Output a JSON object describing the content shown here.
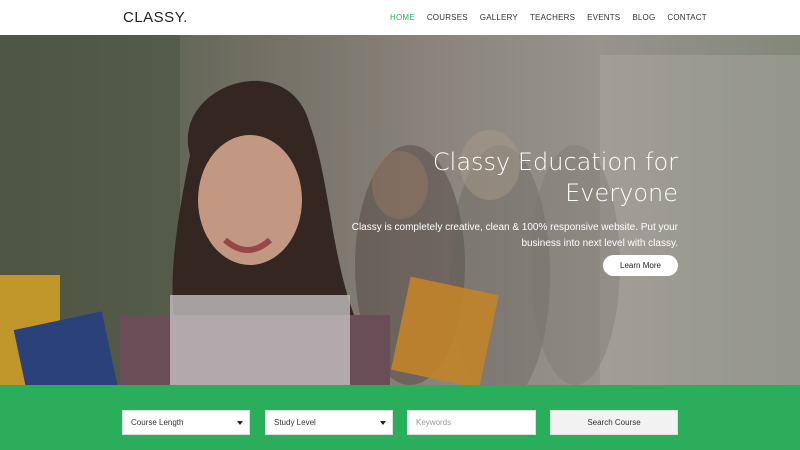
{
  "header": {
    "logo": "CLASSY.",
    "nav": [
      {
        "label": "HOME",
        "active": true
      },
      {
        "label": "COURSES"
      },
      {
        "label": "GALLERY"
      },
      {
        "label": "TEACHERS"
      },
      {
        "label": "EVENTS"
      },
      {
        "label": "BLOG"
      },
      {
        "label": "CONTACT"
      }
    ]
  },
  "hero": {
    "title": "Classy Education for Everyone",
    "subtitle": "Classy is completely creative, clean & 100% responsive website. Put your business into next level with classy.",
    "cta": "Learn More"
  },
  "search": {
    "course_length": "Course Length",
    "study_level": "Study Level",
    "keywords_placeholder": "Keywords",
    "button": "Search Course"
  },
  "colors": {
    "accent": "#2aae5b"
  }
}
